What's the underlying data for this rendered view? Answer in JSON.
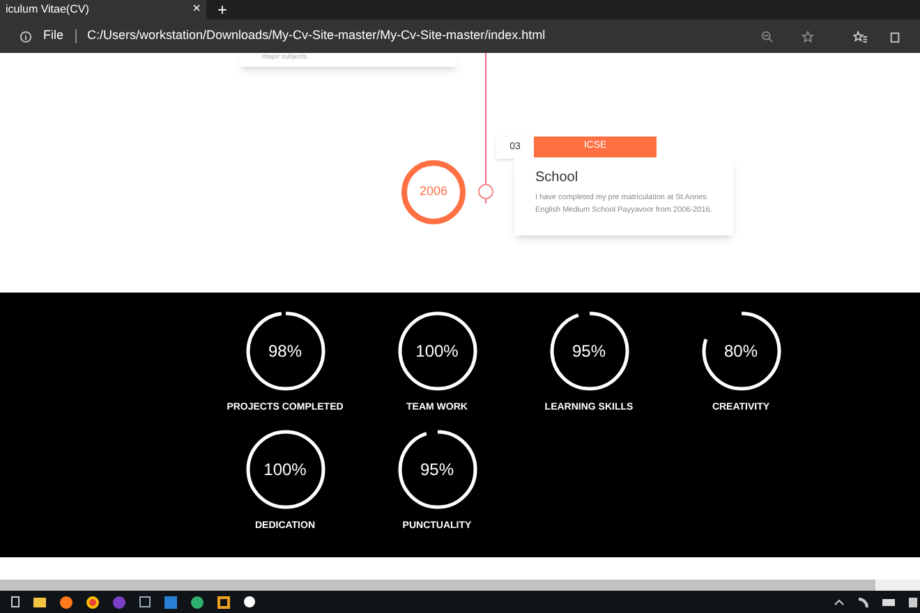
{
  "browser": {
    "tab_title": "iculum Vitae(CV)",
    "tab_close": "×",
    "new_tab": "+",
    "address_scheme": "File",
    "address": "C:/Users/workstation/Downloads/My-Cv-Site-master/My-Cv-Site-master/index.html"
  },
  "timeline": {
    "previous_card_text": "major subjects.",
    "year": "2006",
    "number": "03",
    "tag": "ICSE",
    "title": "School",
    "description": "I have completed my pre matriculation at St.Annes English Medium School Payyavoor from 2006-2016."
  },
  "skills": [
    {
      "value": "98%",
      "label": "PROJECTS COMPLETED",
      "level": 0.98
    },
    {
      "value": "100%",
      "label": "TEAM WORK",
      "level": 1
    },
    {
      "value": "95%",
      "label": "LEARNING SKILLS",
      "level": 0.95
    },
    {
      "value": "80%",
      "label": "CREATIVITY",
      "level": 0.8
    },
    {
      "value": "100%",
      "label": "DEDICATION",
      "level": 1
    },
    {
      "value": "95%",
      "label": "PUNCTUALITY",
      "level": 0.95
    }
  ]
}
